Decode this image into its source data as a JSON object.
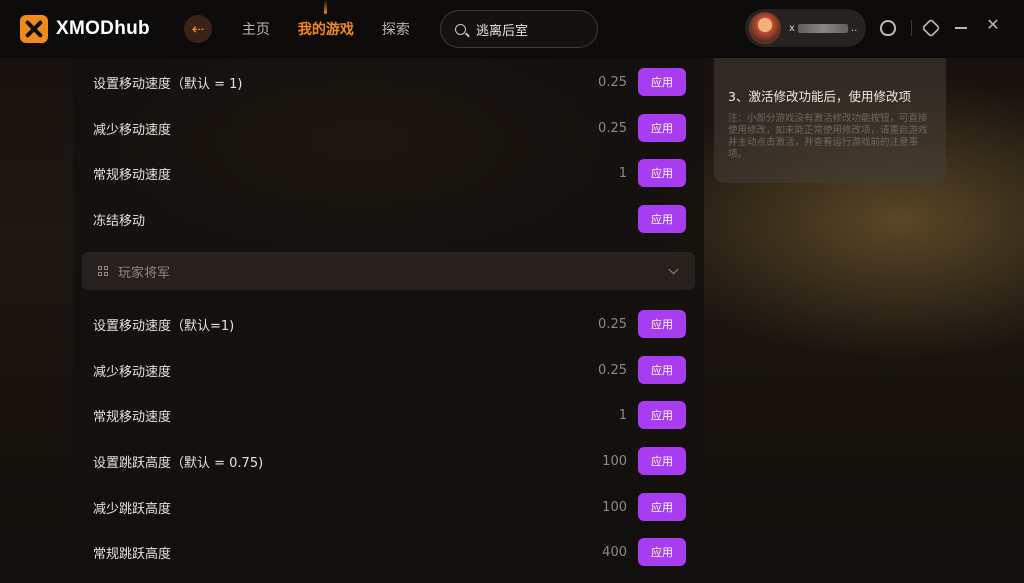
{
  "app": {
    "brand": "XMODhub"
  },
  "colors": {
    "accent": "#f28a1a",
    "apply_button": "#a73cf0"
  },
  "header": {
    "back_icon": "back-arrow-icon",
    "nav": [
      {
        "label": "主页",
        "active": false
      },
      {
        "label": "我的游戏",
        "active": true
      },
      {
        "label": "探索",
        "active": false
      }
    ],
    "search": {
      "value": "逃离后室"
    },
    "user": {
      "name_prefix": "x",
      "name_suffix": ".."
    },
    "icons": [
      "support-icon",
      "settings-icon",
      "minimize-icon",
      "close-icon"
    ]
  },
  "mods": {
    "apply_label": "应用",
    "group_one": [
      {
        "label": "设置移动速度（默认 = 1)",
        "value": "0.25"
      },
      {
        "label": "减少移动速度",
        "value": "0.25"
      },
      {
        "label": "常规移动速度",
        "value": "1"
      },
      {
        "label": "冻结移动",
        "value": ""
      }
    ],
    "section": {
      "title": "玩家将军"
    },
    "group_two": [
      {
        "label": "设置移动速度（默认=1)",
        "value": "0.25"
      },
      {
        "label": "减少移动速度",
        "value": "0.25"
      },
      {
        "label": "常规移动速度",
        "value": "1"
      },
      {
        "label": "设置跳跃高度（默认 = 0.75)",
        "value": "100"
      },
      {
        "label": "减少跳跃高度",
        "value": "100"
      },
      {
        "label": "常规跳跃高度",
        "value": "400"
      }
    ]
  },
  "info": {
    "step3": "3、激活修改功能后，使用修改项",
    "note": "注：小部分游戏没有激活修改功能按钮，可直接使用修改，如未能正常使用修改项，请重启游戏并主动点击激活，并查看运行游戏前的注意事项。"
  }
}
